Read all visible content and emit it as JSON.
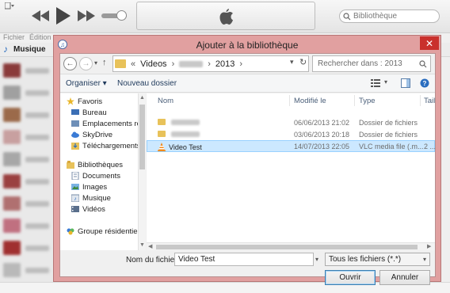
{
  "itunes": {
    "search_placeholder": "Bibliothèque",
    "menu": [
      "Fichier",
      "Édition"
    ],
    "source_label": "Musique",
    "accent_color": "#2a6dbf"
  },
  "dialog": {
    "title": "Ajouter à la bibliothèque",
    "close_glyph": "✕",
    "address": {
      "chevron": "«",
      "crumbs": [
        "Videos",
        "2013"
      ],
      "separator": "›"
    },
    "search_placeholder": "Rechercher dans : 2013",
    "toolbar": {
      "organize_label": "Organiser ▾",
      "new_folder_label": "Nouveau dossier"
    },
    "nav": {
      "favorites": "Favoris",
      "desktop": "Bureau",
      "recent": "Emplacements ré",
      "skydrive": "SkyDrive",
      "downloads": "Téléchargements",
      "libraries": "Bibliothèques",
      "documents": "Documents",
      "images": "Images",
      "music": "Musique",
      "videos": "Vidéos",
      "homegroup": "Groupe résidentiel"
    },
    "columns": {
      "name": "Nom",
      "modified": "Modifié le",
      "type": "Type",
      "size": "Taille"
    },
    "files": [
      {
        "name": "",
        "modified": "06/06/2013 21:02",
        "type": "Dossier de fichiers",
        "size": ""
      },
      {
        "name": "",
        "modified": "03/06/2013 20:18",
        "type": "Dossier de fichiers",
        "size": ""
      },
      {
        "name": "Video Test",
        "modified": "14/07/2013 22:05",
        "type": "VLC media file (.m...",
        "size": "2 ..."
      }
    ],
    "filename_label": "Nom du fichier :",
    "filename_value": "Video Test",
    "filetype_value": "Tous les fichiers (*.*)",
    "open_label": "Ouvrir",
    "cancel_label": "Annuler"
  }
}
